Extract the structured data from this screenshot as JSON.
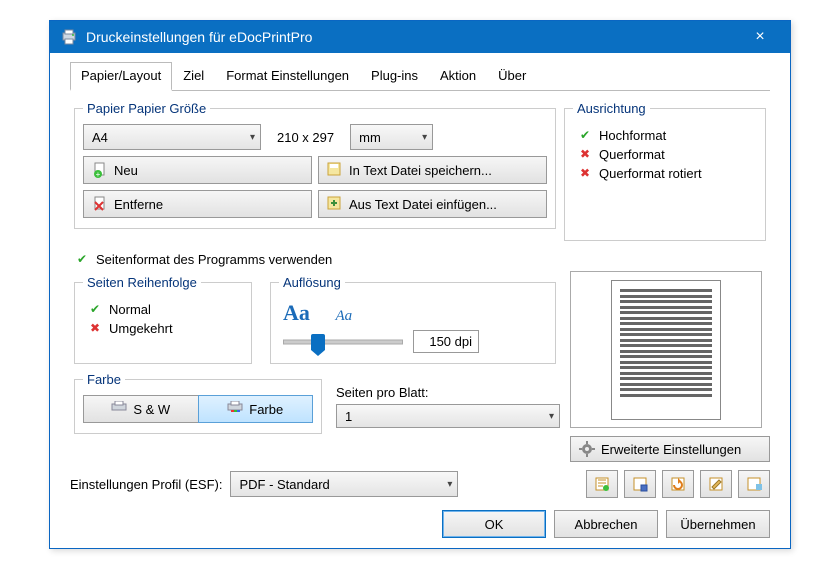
{
  "window": {
    "title": "Druckeinstellungen für eDocPrintPro"
  },
  "tabs": [
    "Papier/Layout",
    "Ziel",
    "Format Einstellungen",
    "Plug-ins",
    "Aktion",
    "Über"
  ],
  "active_tab": 0,
  "paper_group": {
    "legend": "Papier Papier Größe",
    "size_selected": "A4",
    "dimensions": "210 x 297",
    "unit_selected": "mm",
    "buttons": {
      "new": "Neu",
      "remove": "Entferne",
      "save_txt": "In Text Datei speichern...",
      "load_txt": "Aus Text Datei einfügen..."
    }
  },
  "orientation": {
    "legend": "Ausrichtung",
    "options": {
      "portrait": "Hochformat",
      "landscape": "Querformat",
      "landscape_rot": "Querformat rotiert"
    },
    "selected": "portrait"
  },
  "use_program_format": {
    "label": "Seitenformat des Programms verwenden",
    "checked": true
  },
  "page_order": {
    "legend": "Seiten Reihenfolge",
    "options": {
      "normal": "Normal",
      "reversed": "Umgekehrt"
    },
    "selected": "normal"
  },
  "resolution": {
    "legend": "Auflösung",
    "value": "150 dpi"
  },
  "color": {
    "legend": "Farbe",
    "options": {
      "bw": "S & W",
      "color": "Farbe"
    },
    "selected": "color"
  },
  "pages_per_sheet": {
    "label": "Seiten pro Blatt:",
    "value": "1"
  },
  "extended_settings": {
    "label": "Erweiterte Einstellungen"
  },
  "profile": {
    "label": "Einstellungen Profil (ESF):",
    "value": "PDF - Standard"
  },
  "profile_icons": [
    "profile-open-icon",
    "profile-save-icon",
    "profile-refresh-icon",
    "profile-edit-icon",
    "profile-add-icon"
  ],
  "dialog_buttons": {
    "ok": "OK",
    "cancel": "Abbrechen",
    "apply": "Übernehmen"
  }
}
